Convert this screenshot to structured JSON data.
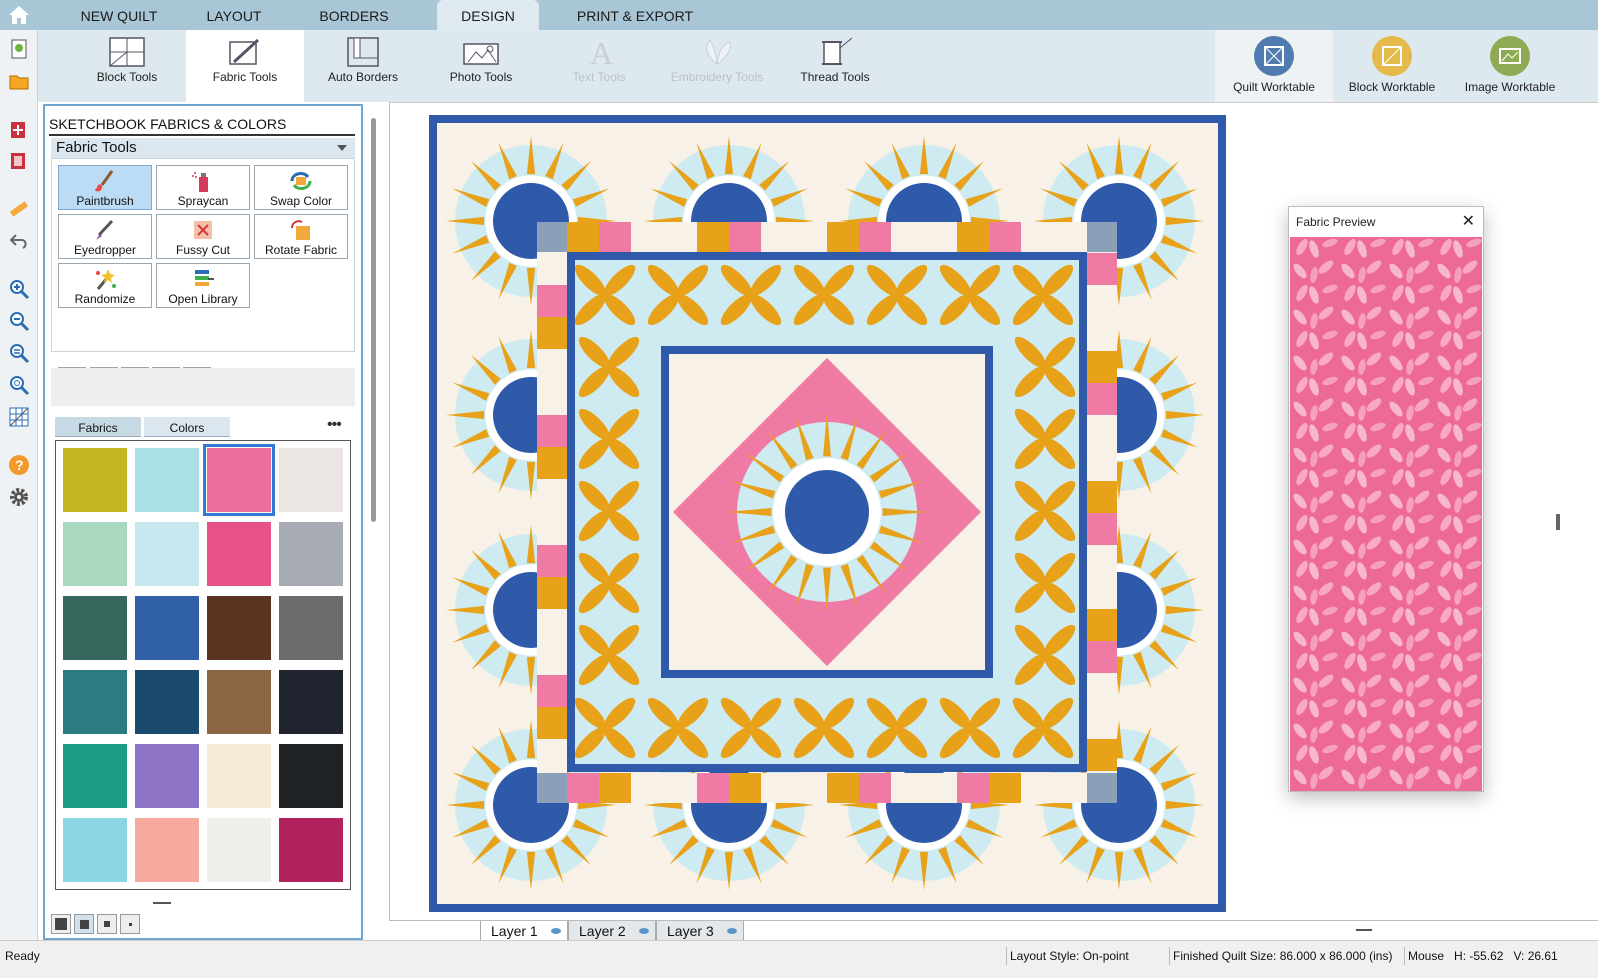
{
  "menu": {
    "tabs": [
      {
        "label": "NEW QUILT"
      },
      {
        "label": "LAYOUT"
      },
      {
        "label": "BORDERS"
      },
      {
        "label": "DESIGN"
      },
      {
        "label": "PRINT & EXPORT"
      }
    ],
    "active": "DESIGN"
  },
  "ribbon": {
    "tools": [
      {
        "label": "Block Tools",
        "icon": "block-tools-icon"
      },
      {
        "label": "Fabric Tools",
        "icon": "fabric-tools-icon"
      },
      {
        "label": "Auto Borders",
        "icon": "auto-borders-icon"
      },
      {
        "label": "Photo Tools",
        "icon": "photo-tools-icon"
      },
      {
        "label": "Text Tools",
        "icon": "text-tools-icon"
      },
      {
        "label": "Embroidery Tools",
        "icon": "embroidery-tools-icon"
      },
      {
        "label": "Thread Tools",
        "icon": "thread-tools-icon"
      }
    ],
    "worktables": [
      {
        "label": "Quilt Worktable",
        "color": "#4f7bb0"
      },
      {
        "label": "Block Worktable",
        "color": "#e5b94a"
      },
      {
        "label": "Image Worktable",
        "color": "#8eaa52"
      }
    ]
  },
  "panel": {
    "title": "SKETCHBOOK FABRICS & COLORS",
    "section": "Fabric Tools",
    "tools": [
      {
        "label": "Paintbrush"
      },
      {
        "label": "Spraycan"
      },
      {
        "label": "Swap Color"
      },
      {
        "label": "Eyedropper"
      },
      {
        "label": "Fussy Cut"
      },
      {
        "label": "Rotate Fabric"
      },
      {
        "label": "Randomize"
      },
      {
        "label": "Open Library"
      }
    ],
    "tabs": {
      "fabrics": "Fabrics",
      "colors": "Colors"
    },
    "more": "•••",
    "swatches": [
      "#c2b521",
      "#a9e0e6",
      "#ec6e9c",
      "#ebe6e3",
      "#a8d8c0",
      "#c7e8ef",
      "#e8508a",
      "#a7abb4",
      "#36685d",
      "#3060a6",
      "#5a3421",
      "#6b6b6b",
      "#2d7b82",
      "#1a4a6e",
      "#8b6644",
      "#1f2430",
      "#1d9a84",
      "#8d73c4",
      "#f6ead5",
      "#1f2326",
      "#8dd4e4",
      "#f6a99c",
      "#f0efe9",
      "#b2235d"
    ]
  },
  "preview": {
    "title": "Fabric Preview",
    "close": "✕"
  },
  "layers": [
    {
      "label": "Layer 1"
    },
    {
      "label": "Layer 2"
    },
    {
      "label": "Layer 3"
    }
  ],
  "status": {
    "ready": "Ready",
    "layout": "Layout Style: On-point",
    "size": "Finished Quilt Size: 86.000 x 86.000 (ins)",
    "mouse": "Mouse",
    "h": "H:",
    "hval": "-55.62",
    "v": "V:",
    "vval": "26.61"
  },
  "colors": {
    "blue": "#2f5aaa",
    "gold": "#e8a21a",
    "pink": "#ef7aa3",
    "aqua": "#cdebf0",
    "cream": "#f8f1e7",
    "gray": "#8aa0b8"
  }
}
